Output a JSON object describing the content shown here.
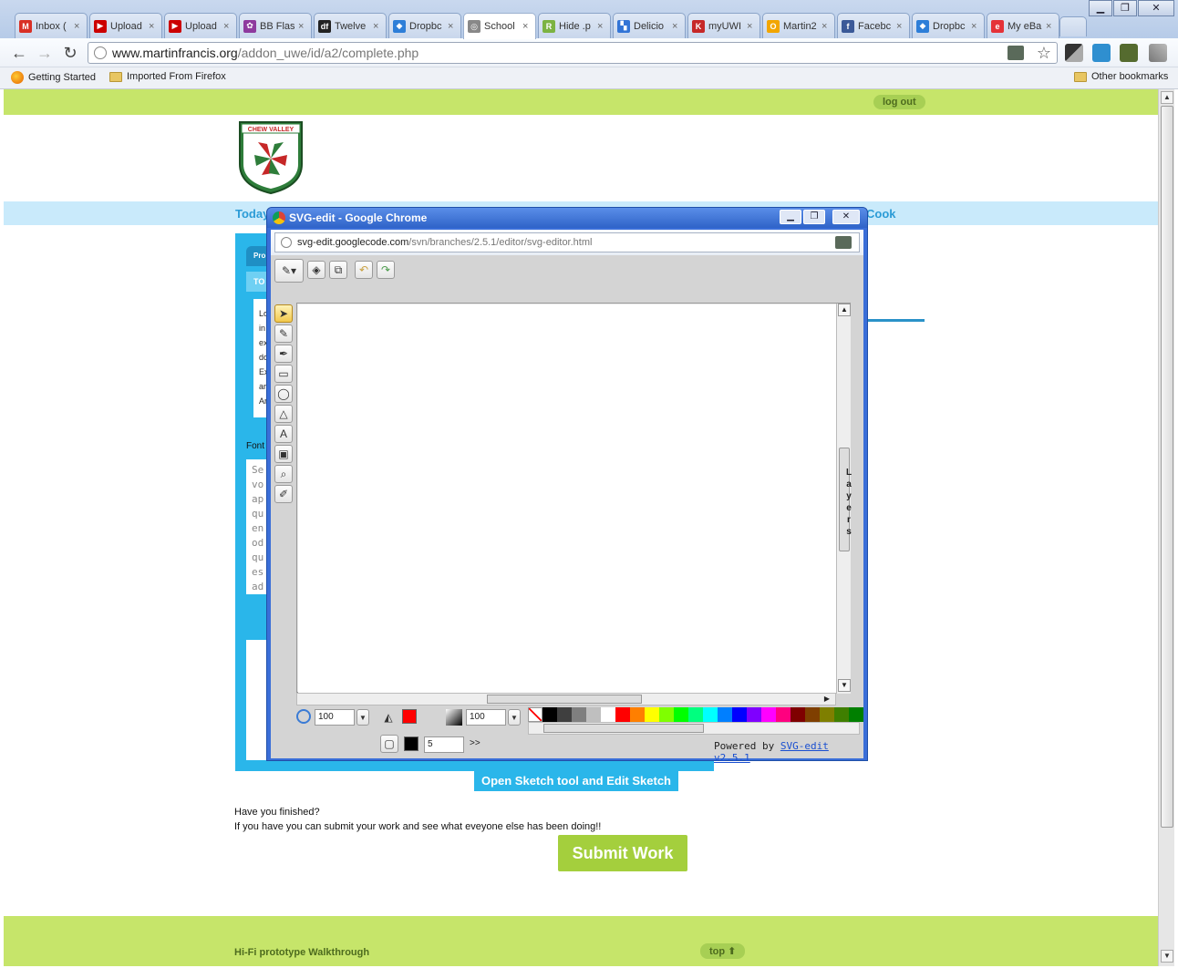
{
  "browser": {
    "tabs": [
      {
        "label": "Inbox (",
        "color": "#d93025",
        "glyph": "M"
      },
      {
        "label": "Upload",
        "color": "#cc0000",
        "glyph": "▶"
      },
      {
        "label": "Upload",
        "color": "#cc0000",
        "glyph": "▶"
      },
      {
        "label": "BB Flas",
        "color": "#8e3a9e",
        "glyph": "✿"
      },
      {
        "label": "Twelve",
        "color": "#222222",
        "glyph": "df"
      },
      {
        "label": "Dropbc",
        "color": "#2d7ed8",
        "glyph": "◆"
      },
      {
        "label": "School",
        "color": "#888888",
        "glyph": "◎"
      },
      {
        "label": "Hide .p",
        "color": "#7cb342",
        "glyph": "R"
      },
      {
        "label": "Delicio",
        "color": "#3274d6",
        "glyph": "▚"
      },
      {
        "label": "myUWI",
        "color": "#c62828",
        "glyph": "K"
      },
      {
        "label": "Martin2",
        "color": "#f2a600",
        "glyph": "O"
      },
      {
        "label": "Facebc",
        "color": "#3b5998",
        "glyph": "f"
      },
      {
        "label": "Dropbc",
        "color": "#2d7ed8",
        "glyph": "◆"
      },
      {
        "label": "My eBa",
        "color": "#e53238",
        "glyph": "e"
      }
    ],
    "tab_close": "×",
    "nav": {
      "back": "←",
      "forward": "→",
      "reload": "↻"
    },
    "url": {
      "host": "www.martinfrancis.org",
      "path": "/addon_uwe/id/a2/complete.php"
    },
    "star": "☆",
    "bookmarks": {
      "getting_started": "Getting Started",
      "imported": "Imported From Firefox",
      "other": "Other bookmarks"
    },
    "window": {
      "minimize": "▁",
      "restore": "❐",
      "close": "✕"
    }
  },
  "page": {
    "logout": "log out",
    "logo_text": "CHEW VALLEY",
    "today_text": "Today",
    "right_blue_text": "Cook",
    "font_label": "Font",
    "panel_fragments": [
      "Pro",
      "TO",
      "Lo",
      "in",
      "ex",
      "do",
      "Ex",
      "ar",
      "Ar"
    ],
    "mono_fragments": [
      "Se",
      "vo",
      "ap",
      "qu",
      "en",
      "od",
      "qu",
      "es",
      "ad"
    ],
    "sketch_button": "Open Sketch tool and Edit Sketch",
    "finished_q": "Have you finished?",
    "finished_msg": "If you have you can submit your work and see what eveyone else has been doing!!",
    "submit": "Submit Work",
    "footer_text": "Hi-Fi prototype Walkthrough",
    "top_link": "top ⬆"
  },
  "popup": {
    "title": "SVG-edit - Google Chrome",
    "url": {
      "host": "svg-edit.googlecode.com",
      "path": "/svn/branches/2.5.1/editor/svg-editor.html"
    },
    "zoom": "100",
    "fill_opacity": "100",
    "stroke_width": "5",
    "more": ">>",
    "layers_label": "Layers",
    "powered_by": "Powered by",
    "powered_link": "SVG-edit v2.5.1",
    "tools": [
      "select-tool",
      "pencil-tool",
      "pen-tool",
      "rect-tool",
      "ellipse-tool",
      "polygon-tool",
      "text-tool",
      "image-tool",
      "zoom-tool",
      "eyedropper-tool"
    ],
    "colors": {
      "fill": "#ff0000",
      "stroke": "#000000"
    },
    "palette": [
      "#000000",
      "#3f3f3f",
      "#7f7f7f",
      "#bfbfbf",
      "#ffffff",
      "#ff0000",
      "#ff7f00",
      "#ffff00",
      "#7fff00",
      "#00ff00",
      "#00ff7f",
      "#00ffff",
      "#007fff",
      "#0000ff",
      "#7f00ff",
      "#ff00ff",
      "#ff007f",
      "#7f0000",
      "#7f3f00",
      "#7f7f00",
      "#3f7f00",
      "#007f00"
    ]
  }
}
